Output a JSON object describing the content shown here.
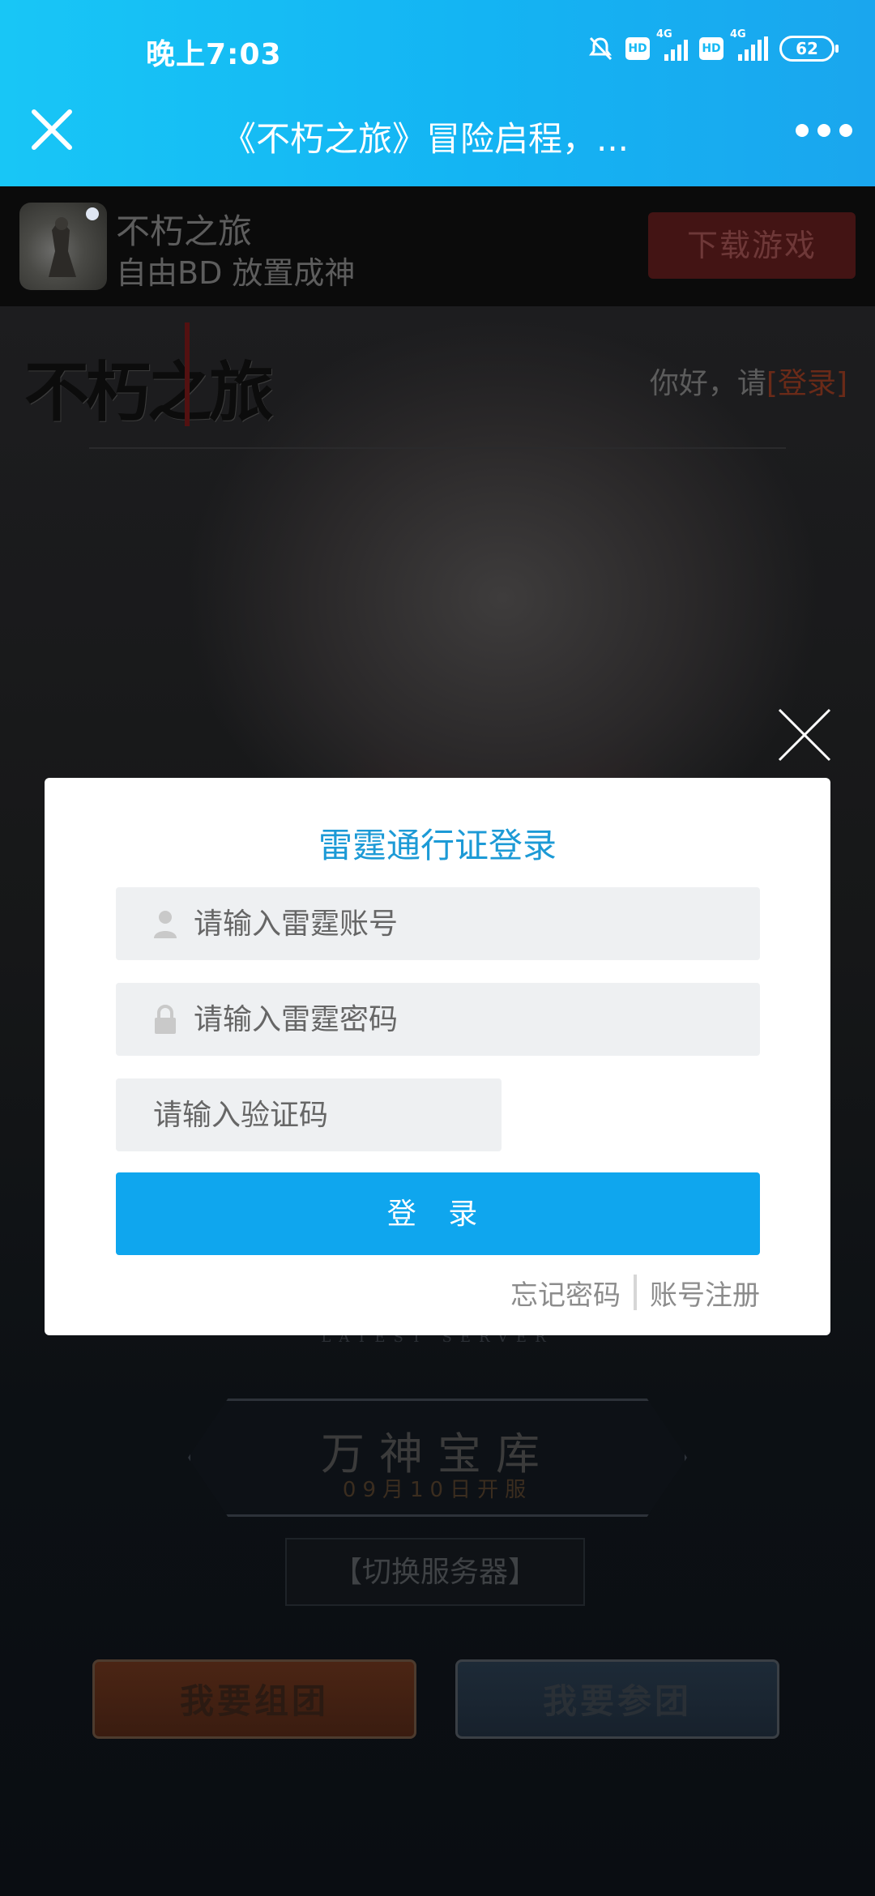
{
  "status_bar": {
    "time": "晚上7:03",
    "hd_label": "HD",
    "network_label": "4G",
    "battery": "62"
  },
  "title_bar": {
    "title": "《不朽之旅》冒险启程，...",
    "close_icon": "close-icon",
    "more_icon": "more-dots-icon"
  },
  "app_banner": {
    "name": "不朽之旅",
    "slogan": "自由BD 放置成神",
    "download_label": "下载游戏"
  },
  "hero": {
    "logo_text": "不朽之旅",
    "greeting_prefix": "你好，请",
    "login_link": "[登录]",
    "server_sub": "LATEST SERVER",
    "server_name": "万神宝库",
    "server_date": "09月10日开服",
    "switch_server_label": "【切换服务器】",
    "create_team_label": "我要组团",
    "join_team_label": "我要参团"
  },
  "login_modal": {
    "title": "雷霆通行证登录",
    "account_placeholder": "请输入雷霆账号",
    "password_placeholder": "请输入雷霆密码",
    "captcha_placeholder": "请输入验证码",
    "login_label": "登 录",
    "forgot_password": "忘记密码",
    "register": "账号注册"
  },
  "colors": {
    "accent": "#0fa6ee",
    "title_blue": "#1c9ad6",
    "topbar": "#14b4f3"
  }
}
